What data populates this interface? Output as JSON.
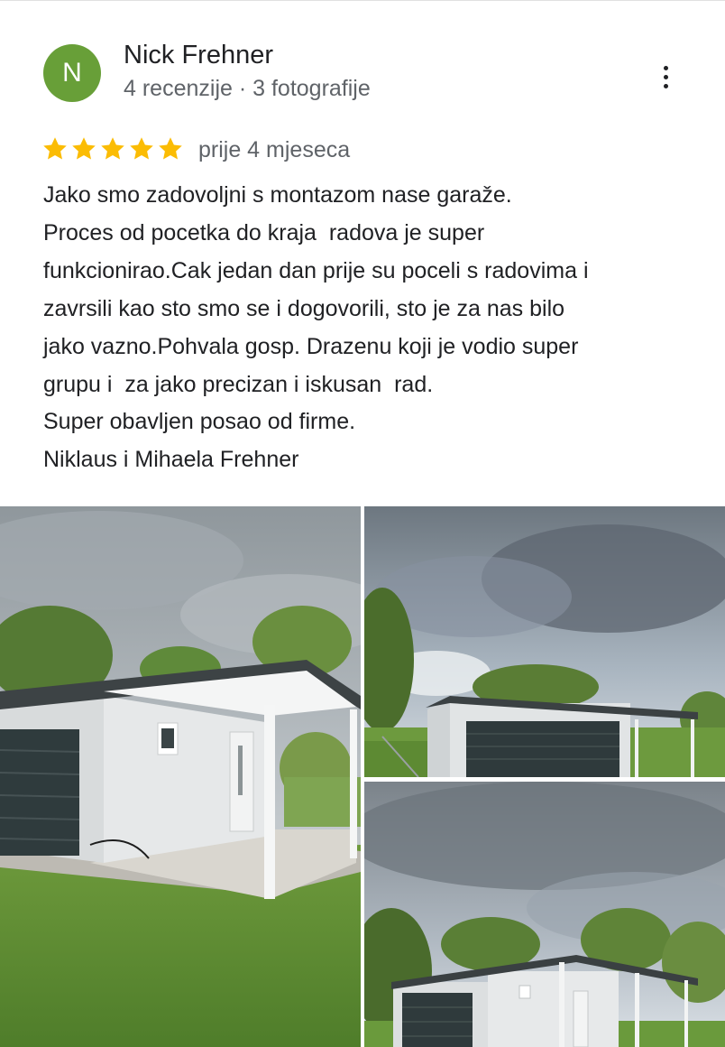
{
  "reviewer": {
    "avatar_initial": "N",
    "avatar_color": "#689f38",
    "name": "Nick Frehner",
    "meta": "4 recenzije · 3 fotografije"
  },
  "menu": {
    "icon": "more-vert-icon"
  },
  "review": {
    "rating": 5,
    "rating_max": 5,
    "star_color": "#fbbc04",
    "date": "prije 4 mjeseca",
    "lines": [
      "Jako smo zadovoljni s montazom nase garaže.",
      "Proces od pocetka do kraja  radova je super",
      "funkcionirao.Cak jedan dan prije su poceli s radovima i",
      "zavrsili kao sto smo se i dogovorili, sto je za nas bilo",
      "jako vazno.Pohvala gosp. Drazenu koji je vodio super",
      "grupu i  za jako precizan i iskusan  rad.",
      "Super obavljen posao od firme.",
      "Niklaus i Mihaela Frehner"
    ]
  },
  "photos": [
    {
      "subject": "garage-with-carport-close"
    },
    {
      "subject": "garage-wide-view"
    },
    {
      "subject": "garage-side-view"
    }
  ]
}
